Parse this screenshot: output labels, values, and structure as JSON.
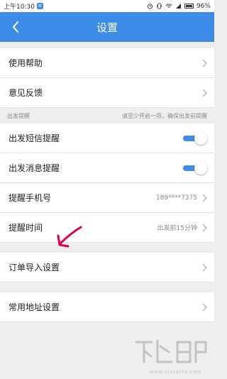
{
  "status_bar": {
    "time": "上午10:30",
    "app_badge": "≡",
    "battery": "96%",
    "icons": [
      "alarm-icon",
      "vibrate-icon",
      "wifi-icon",
      "signal-icon",
      "battery-icon"
    ]
  },
  "header": {
    "title": "设置",
    "back_icon": "back-chevron-icon",
    "background": "#3d8ce8"
  },
  "section1": [
    {
      "label": "使用帮助"
    },
    {
      "label": "意见反馈"
    }
  ],
  "group": {
    "title": "出发提醒",
    "hint": "请至少开启一项，确保出发前提醒"
  },
  "reminders": {
    "sms": {
      "label": "出发短信提醒",
      "enabled": true
    },
    "msg": {
      "label": "出发消息提醒",
      "enabled": true
    },
    "phone": {
      "label": "提醒手机号",
      "value": "189****7375"
    },
    "time": {
      "label": "提醒时间",
      "value": "出发前15分钟"
    }
  },
  "section3": [
    {
      "label": "订单导入设置"
    }
  ],
  "section4": [
    {
      "label": "常用地址设置"
    }
  ],
  "annotation": {
    "color": "#e0004a"
  },
  "watermark": {
    "text": "www.xiazaiba.com"
  }
}
